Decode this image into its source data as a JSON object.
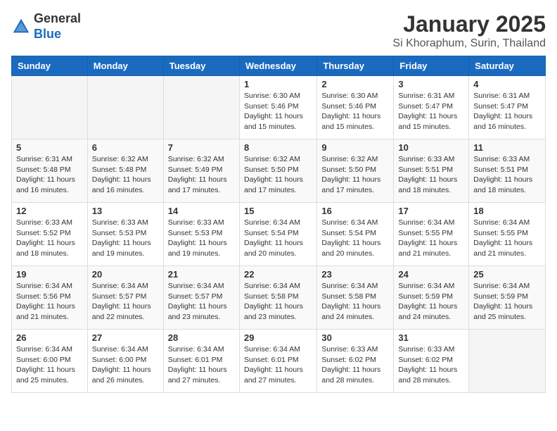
{
  "header": {
    "logo_general": "General",
    "logo_blue": "Blue",
    "calendar_title": "January 2025",
    "calendar_subtitle": "Si Khoraphum, Surin, Thailand"
  },
  "days_of_week": [
    "Sunday",
    "Monday",
    "Tuesday",
    "Wednesday",
    "Thursday",
    "Friday",
    "Saturday"
  ],
  "weeks": [
    [
      {
        "day": "",
        "info": ""
      },
      {
        "day": "",
        "info": ""
      },
      {
        "day": "",
        "info": ""
      },
      {
        "day": "1",
        "info": "Sunrise: 6:30 AM\nSunset: 5:46 PM\nDaylight: 11 hours\nand 15 minutes."
      },
      {
        "day": "2",
        "info": "Sunrise: 6:30 AM\nSunset: 5:46 PM\nDaylight: 11 hours\nand 15 minutes."
      },
      {
        "day": "3",
        "info": "Sunrise: 6:31 AM\nSunset: 5:47 PM\nDaylight: 11 hours\nand 15 minutes."
      },
      {
        "day": "4",
        "info": "Sunrise: 6:31 AM\nSunset: 5:47 PM\nDaylight: 11 hours\nand 16 minutes."
      }
    ],
    [
      {
        "day": "5",
        "info": "Sunrise: 6:31 AM\nSunset: 5:48 PM\nDaylight: 11 hours\nand 16 minutes."
      },
      {
        "day": "6",
        "info": "Sunrise: 6:32 AM\nSunset: 5:48 PM\nDaylight: 11 hours\nand 16 minutes."
      },
      {
        "day": "7",
        "info": "Sunrise: 6:32 AM\nSunset: 5:49 PM\nDaylight: 11 hours\nand 17 minutes."
      },
      {
        "day": "8",
        "info": "Sunrise: 6:32 AM\nSunset: 5:50 PM\nDaylight: 11 hours\nand 17 minutes."
      },
      {
        "day": "9",
        "info": "Sunrise: 6:32 AM\nSunset: 5:50 PM\nDaylight: 11 hours\nand 17 minutes."
      },
      {
        "day": "10",
        "info": "Sunrise: 6:33 AM\nSunset: 5:51 PM\nDaylight: 11 hours\nand 18 minutes."
      },
      {
        "day": "11",
        "info": "Sunrise: 6:33 AM\nSunset: 5:51 PM\nDaylight: 11 hours\nand 18 minutes."
      }
    ],
    [
      {
        "day": "12",
        "info": "Sunrise: 6:33 AM\nSunset: 5:52 PM\nDaylight: 11 hours\nand 18 minutes."
      },
      {
        "day": "13",
        "info": "Sunrise: 6:33 AM\nSunset: 5:53 PM\nDaylight: 11 hours\nand 19 minutes."
      },
      {
        "day": "14",
        "info": "Sunrise: 6:33 AM\nSunset: 5:53 PM\nDaylight: 11 hours\nand 19 minutes."
      },
      {
        "day": "15",
        "info": "Sunrise: 6:34 AM\nSunset: 5:54 PM\nDaylight: 11 hours\nand 20 minutes."
      },
      {
        "day": "16",
        "info": "Sunrise: 6:34 AM\nSunset: 5:54 PM\nDaylight: 11 hours\nand 20 minutes."
      },
      {
        "day": "17",
        "info": "Sunrise: 6:34 AM\nSunset: 5:55 PM\nDaylight: 11 hours\nand 21 minutes."
      },
      {
        "day": "18",
        "info": "Sunrise: 6:34 AM\nSunset: 5:55 PM\nDaylight: 11 hours\nand 21 minutes."
      }
    ],
    [
      {
        "day": "19",
        "info": "Sunrise: 6:34 AM\nSunset: 5:56 PM\nDaylight: 11 hours\nand 21 minutes."
      },
      {
        "day": "20",
        "info": "Sunrise: 6:34 AM\nSunset: 5:57 PM\nDaylight: 11 hours\nand 22 minutes."
      },
      {
        "day": "21",
        "info": "Sunrise: 6:34 AM\nSunset: 5:57 PM\nDaylight: 11 hours\nand 23 minutes."
      },
      {
        "day": "22",
        "info": "Sunrise: 6:34 AM\nSunset: 5:58 PM\nDaylight: 11 hours\nand 23 minutes."
      },
      {
        "day": "23",
        "info": "Sunrise: 6:34 AM\nSunset: 5:58 PM\nDaylight: 11 hours\nand 24 minutes."
      },
      {
        "day": "24",
        "info": "Sunrise: 6:34 AM\nSunset: 5:59 PM\nDaylight: 11 hours\nand 24 minutes."
      },
      {
        "day": "25",
        "info": "Sunrise: 6:34 AM\nSunset: 5:59 PM\nDaylight: 11 hours\nand 25 minutes."
      }
    ],
    [
      {
        "day": "26",
        "info": "Sunrise: 6:34 AM\nSunset: 6:00 PM\nDaylight: 11 hours\nand 25 minutes."
      },
      {
        "day": "27",
        "info": "Sunrise: 6:34 AM\nSunset: 6:00 PM\nDaylight: 11 hours\nand 26 minutes."
      },
      {
        "day": "28",
        "info": "Sunrise: 6:34 AM\nSunset: 6:01 PM\nDaylight: 11 hours\nand 27 minutes."
      },
      {
        "day": "29",
        "info": "Sunrise: 6:34 AM\nSunset: 6:01 PM\nDaylight: 11 hours\nand 27 minutes."
      },
      {
        "day": "30",
        "info": "Sunrise: 6:33 AM\nSunset: 6:02 PM\nDaylight: 11 hours\nand 28 minutes."
      },
      {
        "day": "31",
        "info": "Sunrise: 6:33 AM\nSunset: 6:02 PM\nDaylight: 11 hours\nand 28 minutes."
      },
      {
        "day": "",
        "info": ""
      }
    ]
  ]
}
